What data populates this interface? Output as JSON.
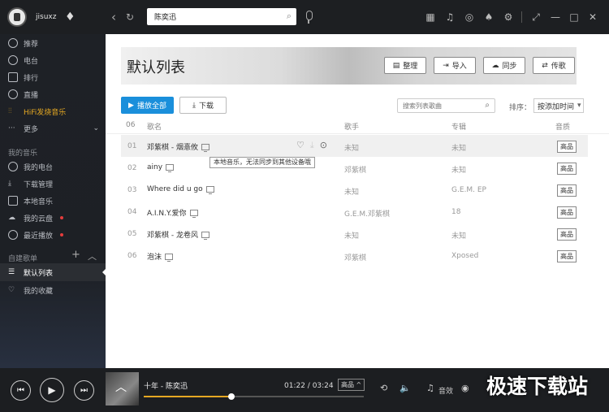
{
  "user": {
    "name": "jisuxz"
  },
  "search": {
    "value": "陈奕迅"
  },
  "sidebar": {
    "items": [
      {
        "label": "推荐"
      },
      {
        "label": "电台"
      },
      {
        "label": "排行"
      },
      {
        "label": "直播"
      },
      {
        "label": "HiFi发烧音乐"
      },
      {
        "label": "更多"
      }
    ],
    "my_music_title": "我的音乐",
    "my_music": [
      {
        "label": "我的电台"
      },
      {
        "label": "下载管理"
      },
      {
        "label": "本地音乐"
      },
      {
        "label": "我的云盘"
      },
      {
        "label": "最近播放"
      }
    ],
    "custom_title": "自建歌单",
    "custom": [
      {
        "label": "默认列表"
      },
      {
        "label": "我的收藏"
      }
    ],
    "colors": {
      "hifi": "#e5a823",
      "badge": "#e53c3c"
    }
  },
  "main": {
    "title": "默认列表",
    "banner_buttons": [
      {
        "label": "整理"
      },
      {
        "label": "导入"
      },
      {
        "label": "同步"
      },
      {
        "label": "传歌"
      }
    ],
    "play_all": "播放全部",
    "download": "下载",
    "list_search_placeholder": "搜索列表歌曲",
    "sort_label": "排序：",
    "sort_value": "按添加时间",
    "header": {
      "count": "06",
      "name": "歌名",
      "singer": "歌手",
      "album": "专辑",
      "quality": "音质"
    },
    "tooltip": "本地音乐，无法同步到其他设备哦",
    "rows": [
      {
        "num": "01",
        "name": "邓紫棋 - 烟憙攸",
        "singer": "未知",
        "album": "未知",
        "quality": "高品"
      },
      {
        "num": "02",
        "name": "ainy",
        "singer": "邓紫棋",
        "album": "未知",
        "quality": "高品"
      },
      {
        "num": "03",
        "name": "Where did u go",
        "singer": "未知",
        "album": "G.E.M. EP",
        "quality": "高品"
      },
      {
        "num": "04",
        "name": "A.I.N.Y.爱你",
        "singer": "G.E.M.邓紫棋",
        "album": "18",
        "quality": "高品"
      },
      {
        "num": "05",
        "name": "邓紫棋 - 龙卷风",
        "singer": "未知",
        "album": "未知",
        "quality": "高品"
      },
      {
        "num": "06",
        "name": "泡沫",
        "singer": "邓紫棋",
        "album": "Xposed",
        "quality": "高品"
      }
    ],
    "accent": "#1a8fdb"
  },
  "player": {
    "title": "十年 - 陈奕迅",
    "time": "01:22 / 03:24",
    "quality": "高品 ^",
    "effect": "音效",
    "progress": 0.4,
    "progress_color": "#e5a823"
  },
  "watermark": "极速下载站"
}
